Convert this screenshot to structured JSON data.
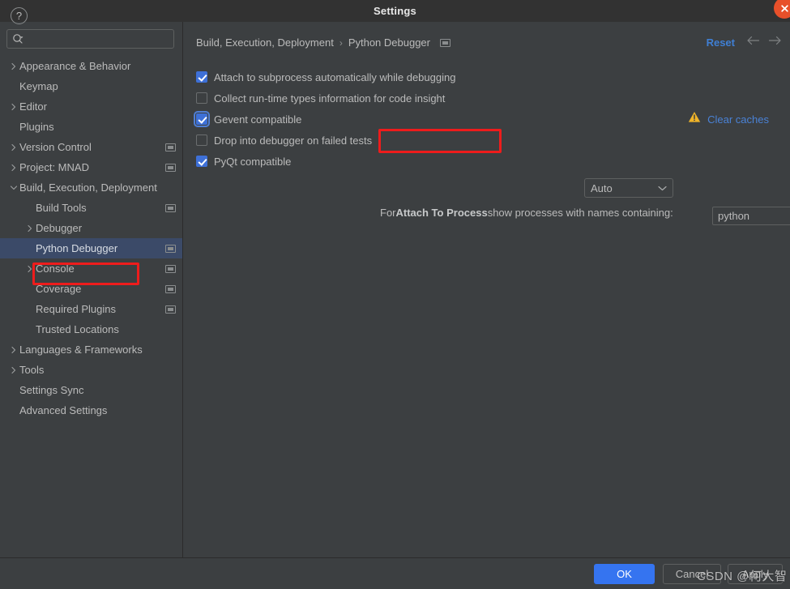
{
  "window": {
    "title": "Settings",
    "close_icon": "close-circle-icon"
  },
  "search": {
    "value": "",
    "placeholder": "",
    "icon": "search-icon"
  },
  "sidebar": {
    "items": [
      {
        "label": "Appearance & Behavior",
        "level": 0,
        "twisty": "chevron-right",
        "badge": false,
        "selected": false
      },
      {
        "label": "Keymap",
        "level": 0,
        "twisty": "none",
        "badge": false,
        "selected": false
      },
      {
        "label": "Editor",
        "level": 0,
        "twisty": "chevron-right",
        "badge": false,
        "selected": false
      },
      {
        "label": "Plugins",
        "level": 0,
        "twisty": "none",
        "badge": false,
        "selected": false
      },
      {
        "label": "Version Control",
        "level": 0,
        "twisty": "chevron-right",
        "badge": true,
        "selected": false
      },
      {
        "label": "Project: MNAD",
        "level": 0,
        "twisty": "chevron-right",
        "badge": true,
        "selected": false
      },
      {
        "label": "Build, Execution, Deployment",
        "level": 0,
        "twisty": "chevron-down",
        "badge": false,
        "selected": false
      },
      {
        "label": "Build Tools",
        "level": 1,
        "twisty": "none",
        "badge": true,
        "selected": false
      },
      {
        "label": "Debugger",
        "level": 1,
        "twisty": "chevron-right",
        "badge": false,
        "selected": false
      },
      {
        "label": "Python Debugger",
        "level": 1,
        "twisty": "none",
        "badge": true,
        "selected": true
      },
      {
        "label": "Console",
        "level": 1,
        "twisty": "chevron-right",
        "badge": true,
        "selected": false
      },
      {
        "label": "Coverage",
        "level": 1,
        "twisty": "none",
        "badge": true,
        "selected": false
      },
      {
        "label": "Required Plugins",
        "level": 1,
        "twisty": "none",
        "badge": true,
        "selected": false
      },
      {
        "label": "Trusted Locations",
        "level": 1,
        "twisty": "none",
        "badge": false,
        "selected": false
      },
      {
        "label": "Languages & Frameworks",
        "level": 0,
        "twisty": "chevron-right",
        "badge": false,
        "selected": false
      },
      {
        "label": "Tools",
        "level": 0,
        "twisty": "chevron-right",
        "badge": false,
        "selected": false
      },
      {
        "label": "Settings Sync",
        "level": 0,
        "twisty": "none",
        "badge": false,
        "selected": false
      },
      {
        "label": "Advanced Settings",
        "level": 0,
        "twisty": "none",
        "badge": false,
        "selected": false
      }
    ]
  },
  "main": {
    "breadcrumb": {
      "root": "Build, Execution, Deployment",
      "separator": "›",
      "leaf": "Python Debugger",
      "badge_icon": "project-scope-icon"
    },
    "reset_label": "Reset",
    "nav_back_icon": "arrow-left-icon",
    "nav_forward_icon": "arrow-forward-icon",
    "options": [
      {
        "label": "Attach to subprocess automatically while debugging",
        "checked": true,
        "focused": false
      },
      {
        "label": "Collect run-time types information for code insight",
        "checked": false,
        "focused": false
      },
      {
        "label": "Gevent compatible",
        "checked": true,
        "focused": true
      },
      {
        "label": "Drop into debugger on failed tests",
        "checked": false,
        "focused": false
      },
      {
        "label": "PyQt compatible",
        "checked": true,
        "focused": false
      }
    ],
    "pyqt_combo": {
      "value": "Auto",
      "chevron_icon": "chevron-down-icon"
    },
    "clear_caches": {
      "warning_icon": "warning-triangle-icon",
      "label": "Clear caches"
    },
    "attach": {
      "prefix": "For ",
      "emphasis": "Attach To Process",
      "suffix": " show processes with names containing:",
      "value": "python",
      "placeholder": ""
    }
  },
  "footer": {
    "help_icon": "help-question-icon",
    "ok_label": "OK",
    "cancel_label": "Cancel",
    "apply_label": "Apply"
  },
  "watermark": {
    "text": "CSDN @何大智"
  },
  "colors": {
    "accent_blue": "#3574f0",
    "link_blue": "#4a82d6",
    "checkbox_blue": "#3e70d7",
    "selection_blue": "#3b4a68",
    "annotation_red": "#ee1c1c",
    "close_orange": "#e8502a",
    "warning_yellow": "#f0b429",
    "panel_bg": "#3c3f41",
    "titlebar_bg": "#323232",
    "text": "#bbbbbb"
  }
}
